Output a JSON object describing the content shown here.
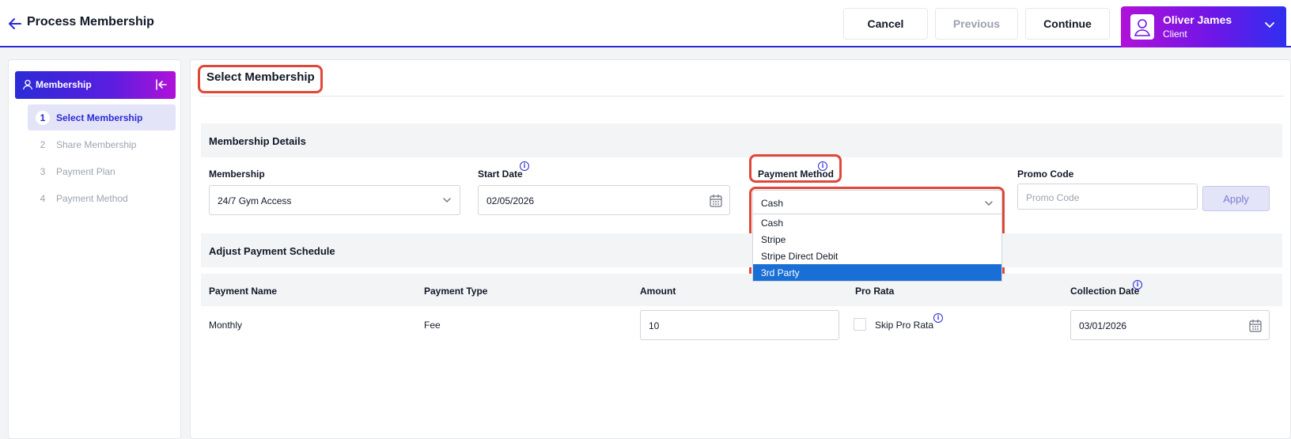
{
  "header": {
    "title": "Process Membership",
    "cancel_label": "Cancel",
    "previous_label": "Previous",
    "continue_label": "Continue",
    "user": {
      "name": "Oliver James",
      "role": "Client"
    }
  },
  "sidebar": {
    "title": "Membership",
    "steps": [
      {
        "num": "1",
        "label": "Select Membership"
      },
      {
        "num": "2",
        "label": "Share Membership"
      },
      {
        "num": "3",
        "label": "Payment Plan"
      },
      {
        "num": "4",
        "label": "Payment Method"
      }
    ]
  },
  "main": {
    "section_title": "Select Membership",
    "details": {
      "title": "Membership Details",
      "membership_label": "Membership",
      "membership_value": "24/7 Gym Access",
      "start_date_label": "Start Date",
      "start_date_value": "02/05/2026",
      "payment_method_label": "Payment Method",
      "payment_method_value": "Cash",
      "payment_method_options": [
        "Cash",
        "Stripe",
        "Stripe Direct Debit",
        "3rd Party"
      ],
      "promo_label": "Promo Code",
      "promo_placeholder": "Promo Code",
      "apply_label": "Apply"
    },
    "schedule": {
      "title": "Adjust Payment Schedule",
      "columns": [
        "Payment Name",
        "Payment Type",
        "Amount",
        "Pro Rata",
        "Collection Date"
      ],
      "row": {
        "name": "Monthly",
        "type": "Fee",
        "amount": "10",
        "skip_label": "Skip Pro Rata",
        "collection_date": "03/01/2026"
      }
    }
  }
}
